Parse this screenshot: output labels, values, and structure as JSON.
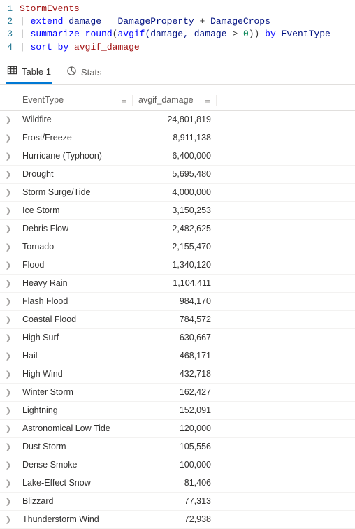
{
  "code": {
    "lines": [
      {
        "num": "1",
        "tokens": [
          {
            "t": "StormEvents",
            "c": "tok-strcol"
          }
        ]
      },
      {
        "num": "2",
        "tokens": [
          {
            "t": "| ",
            "c": "tok-pipe"
          },
          {
            "t": "extend",
            "c": "tok-keyword"
          },
          {
            "t": " damage ",
            "c": "tok-col"
          },
          {
            "t": "=",
            "c": "tok-op"
          },
          {
            "t": " DamageProperty ",
            "c": "tok-col"
          },
          {
            "t": "+",
            "c": "tok-op"
          },
          {
            "t": " DamageCrops",
            "c": "tok-col"
          }
        ]
      },
      {
        "num": "3",
        "tokens": [
          {
            "t": "| ",
            "c": "tok-pipe"
          },
          {
            "t": "summarize",
            "c": "tok-keyword"
          },
          {
            "t": " ",
            "c": ""
          },
          {
            "t": "round",
            "c": "tok-func"
          },
          {
            "t": "(",
            "c": "tok-op"
          },
          {
            "t": "avgif",
            "c": "tok-func"
          },
          {
            "t": "(damage, damage ",
            "c": "tok-col"
          },
          {
            "t": ">",
            "c": "tok-op"
          },
          {
            "t": " ",
            "c": ""
          },
          {
            "t": "0",
            "c": "tok-num"
          },
          {
            "t": "))",
            "c": "tok-op"
          },
          {
            "t": " ",
            "c": ""
          },
          {
            "t": "by",
            "c": "tok-keyword"
          },
          {
            "t": " EventType",
            "c": "tok-col"
          }
        ]
      },
      {
        "num": "4",
        "tokens": [
          {
            "t": "| ",
            "c": "tok-pipe"
          },
          {
            "t": "sort",
            "c": "tok-keyword"
          },
          {
            "t": " ",
            "c": ""
          },
          {
            "t": "by",
            "c": "tok-keyword"
          },
          {
            "t": " avgif_damage",
            "c": "tok-strcol"
          }
        ]
      }
    ]
  },
  "tabs": {
    "table": "Table 1",
    "stats": "Stats"
  },
  "headers": {
    "event": "EventType",
    "damage": "avgif_damage",
    "menu_glyph": "≡"
  },
  "rows": [
    {
      "event": "Wildfire",
      "damage": "24,801,819"
    },
    {
      "event": "Frost/Freeze",
      "damage": "8,911,138"
    },
    {
      "event": "Hurricane (Typhoon)",
      "damage": "6,400,000"
    },
    {
      "event": "Drought",
      "damage": "5,695,480"
    },
    {
      "event": "Storm Surge/Tide",
      "damage": "4,000,000"
    },
    {
      "event": "Ice Storm",
      "damage": "3,150,253"
    },
    {
      "event": "Debris Flow",
      "damage": "2,482,625"
    },
    {
      "event": "Tornado",
      "damage": "2,155,470"
    },
    {
      "event": "Flood",
      "damage": "1,340,120"
    },
    {
      "event": "Heavy Rain",
      "damage": "1,104,411"
    },
    {
      "event": "Flash Flood",
      "damage": "984,170"
    },
    {
      "event": "Coastal Flood",
      "damage": "784,572"
    },
    {
      "event": "High Surf",
      "damage": "630,667"
    },
    {
      "event": "Hail",
      "damage": "468,171"
    },
    {
      "event": "High Wind",
      "damage": "432,718"
    },
    {
      "event": "Winter Storm",
      "damage": "162,427"
    },
    {
      "event": "Lightning",
      "damage": "152,091"
    },
    {
      "event": "Astronomical Low Tide",
      "damage": "120,000"
    },
    {
      "event": "Dust Storm",
      "damage": "105,556"
    },
    {
      "event": "Dense Smoke",
      "damage": "100,000"
    },
    {
      "event": "Lake-Effect Snow",
      "damage": "81,406"
    },
    {
      "event": "Blizzard",
      "damage": "77,313"
    },
    {
      "event": "Thunderstorm Wind",
      "damage": "72,938"
    }
  ],
  "chart_data": {
    "type": "table",
    "columns": [
      "EventType",
      "avgif_damage"
    ],
    "data": [
      [
        "Wildfire",
        24801819
      ],
      [
        "Frost/Freeze",
        8911138
      ],
      [
        "Hurricane (Typhoon)",
        6400000
      ],
      [
        "Drought",
        5695480
      ],
      [
        "Storm Surge/Tide",
        4000000
      ],
      [
        "Ice Storm",
        3150253
      ],
      [
        "Debris Flow",
        2482625
      ],
      [
        "Tornado",
        2155470
      ],
      [
        "Flood",
        1340120
      ],
      [
        "Heavy Rain",
        1104411
      ],
      [
        "Flash Flood",
        984170
      ],
      [
        "Coastal Flood",
        784572
      ],
      [
        "High Surf",
        630667
      ],
      [
        "Hail",
        468171
      ],
      [
        "High Wind",
        432718
      ],
      [
        "Winter Storm",
        162427
      ],
      [
        "Lightning",
        152091
      ],
      [
        "Astronomical Low Tide",
        120000
      ],
      [
        "Dust Storm",
        105556
      ],
      [
        "Dense Smoke",
        100000
      ],
      [
        "Lake-Effect Snow",
        81406
      ],
      [
        "Blizzard",
        77313
      ],
      [
        "Thunderstorm Wind",
        72938
      ]
    ]
  }
}
